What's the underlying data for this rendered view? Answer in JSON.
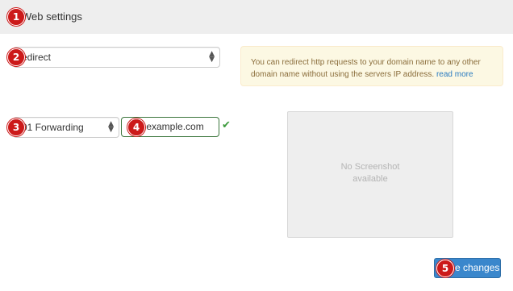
{
  "header": {
    "title": "Web settings",
    "marker": "1"
  },
  "redirect_select": {
    "marker": "2",
    "value": "edirect"
  },
  "forwarding_select": {
    "marker": "3",
    "value": "01 Forwarding"
  },
  "domain_input": {
    "marker": "4",
    "value": ".example.com"
  },
  "info_box": {
    "text": "You can redirect http requests to your domain name to any other domain name without using the servers IP address.",
    "link": "read more"
  },
  "screenshot": {
    "line1": "No Screenshot",
    "line2": "available"
  },
  "save_button": {
    "marker": "5",
    "label": "e changes"
  },
  "colors": {
    "callout": "#cc1a1a",
    "valid": "#3c763d",
    "primary": "#3a87cc",
    "warning_bg": "#fcf8e3",
    "warning_text": "#8a6d3b"
  }
}
